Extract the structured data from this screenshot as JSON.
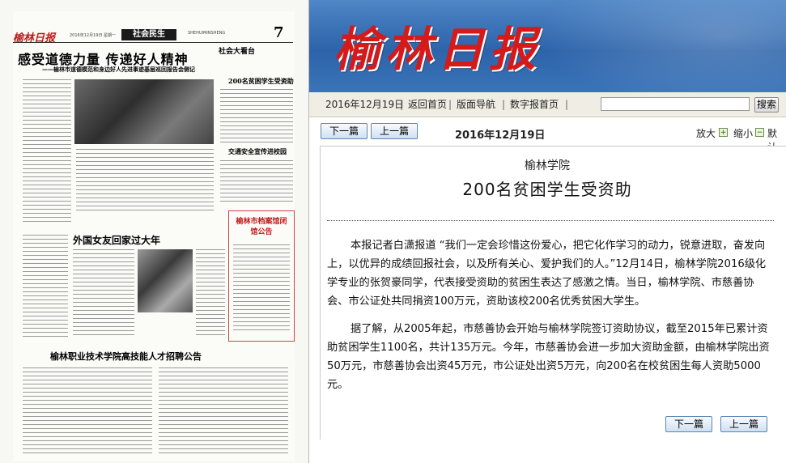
{
  "paper": {
    "masthead": "榆林日报",
    "date_line": "2016年12月19日  星期一",
    "section": "社会民生",
    "section_code": "SHEHUIMINSHENG",
    "page_number": "7",
    "headline": "感受道德力量 传递好人精神",
    "subheadline": "——榆林市道德模范和身边好人先进事迹基层巡回报告会侧记",
    "column_label": "社会大看台",
    "side_title": "200名贫困学生受资助",
    "mid_title": "交通安全宣传进校园",
    "story2_title": "外国女友回家过大年",
    "notice_title": "榆林市档案馆闭馆公告",
    "ad_title": "榆林职业技术学院高技能人才招聘公告"
  },
  "banner": {
    "logo_text": "榆林日报"
  },
  "nav": {
    "date": "2016年12月19日",
    "items": [
      "返回首页",
      "版面导航",
      "数字报首页"
    ],
    "search_placeholder": "",
    "search_button": "搜索"
  },
  "toolbar": {
    "next_page": "下一篇",
    "prev_page": "上一篇",
    "date": "2016年12月19日",
    "zoom_in": "放大",
    "zoom_out": "缩小",
    "default": "默认"
  },
  "article": {
    "kicker": "榆林学院",
    "title": "200名贫困学生受资助",
    "paragraphs": [
      "本报记者白潇报道 “我们一定会珍惜这份爱心，把它化作学习的动力，锐意进取，奋发向上，以优异的成绩回报社会，以及所有关心、爱护我们的人。”12月14日，榆林学院2016级化学专业的张贺豪同学，代表接受资助的贫困生表达了感激之情。当日，榆林学院、市慈善协会、市公证处共同捐资100万元，资助该校200名优秀贫困大学生。",
      "据了解，从2005年起，市慈善协会开始与榆林学院签订资助协议，截至2015年已累计资助贫困学生1100名，共计135万元。今年，市慈善协会进一步加大资助金额，由榆林学院出资50万元，市慈善协会出资45万元，市公证处出资5万元，向200名在校贫困生每人资助5000元。"
    ]
  },
  "colors": {
    "banner_blue": "#2c63aa",
    "logo_red": "#d41a1a",
    "nav_bg": "#f0eee4"
  }
}
